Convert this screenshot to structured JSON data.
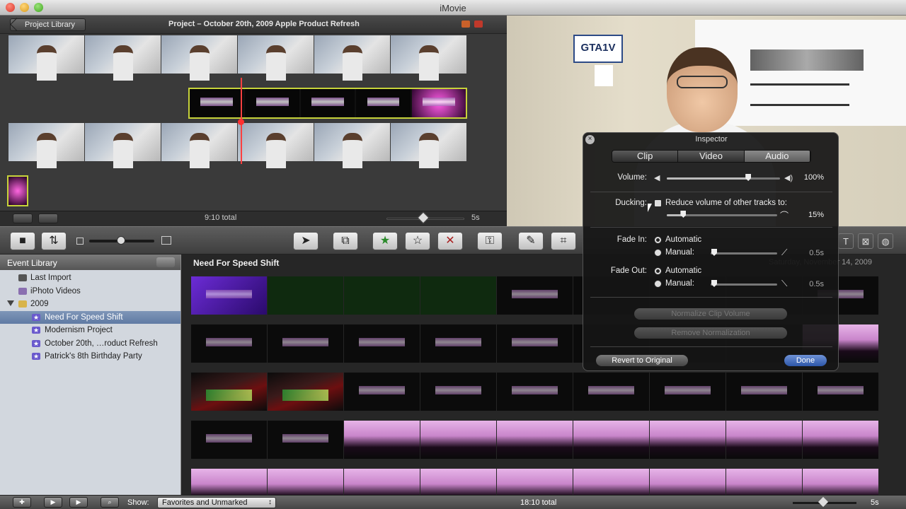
{
  "window": {
    "title": "iMovie"
  },
  "project": {
    "library_button": "Project Library",
    "title": "Project – October 20th, 2009 Apple Product Refresh",
    "total": "9:10 total",
    "zoom_value": "5s"
  },
  "viewer": {
    "plate_text": "GTA1V"
  },
  "event_library": {
    "header": "Event Library",
    "items": [
      {
        "label": "Last Import",
        "icon": "film-icon"
      },
      {
        "label": "iPhoto Videos",
        "icon": "photo-icon"
      },
      {
        "label": "2009",
        "icon": "folder-icon"
      },
      {
        "label": "Need For Speed Shift",
        "icon": "star-event-icon",
        "selected": true
      },
      {
        "label": "Modernism Project",
        "icon": "star-event-icon"
      },
      {
        "label": "October 20th, …roduct Refresh",
        "icon": "star-event-icon"
      },
      {
        "label": "Patrick's 8th Birthday Party",
        "icon": "star-event-icon"
      }
    ]
  },
  "browser": {
    "title": "Need For Speed Shift",
    "date": "Saturday, November 14, 2009"
  },
  "inspector": {
    "title": "Inspector",
    "tabs": [
      "Clip",
      "Video",
      "Audio"
    ],
    "active_tab": "Audio",
    "volume_label": "Volume:",
    "volume_value": "100%",
    "volume_level": 0.72,
    "ducking_label": "Ducking:",
    "ducking_text": "Reduce volume of other tracks to:",
    "ducking_value": "15%",
    "ducking_level": 0.15,
    "fade_in_label": "Fade In:",
    "fade_in_automatic": "Automatic",
    "fade_in_manual": "Manual:",
    "fade_in_value": "0.5s",
    "fade_out_label": "Fade Out:",
    "fade_out_automatic": "Automatic",
    "fade_out_manual": "Manual:",
    "fade_out_value": "0.5s",
    "normalize_button": "Normalize Clip Volume",
    "remove_normalization_button": "Remove Normalization",
    "revert_button": "Revert to Original",
    "done_button": "Done"
  },
  "bottombar": {
    "show_label": "Show:",
    "show_value": "Favorites and Unmarked",
    "total": "18:10 total",
    "zoom_value": "5s"
  },
  "colors": {
    "accent_blue": "#2d56a8",
    "selection_yellow": "#c7d33a",
    "playhead_red": "#ff4040"
  }
}
